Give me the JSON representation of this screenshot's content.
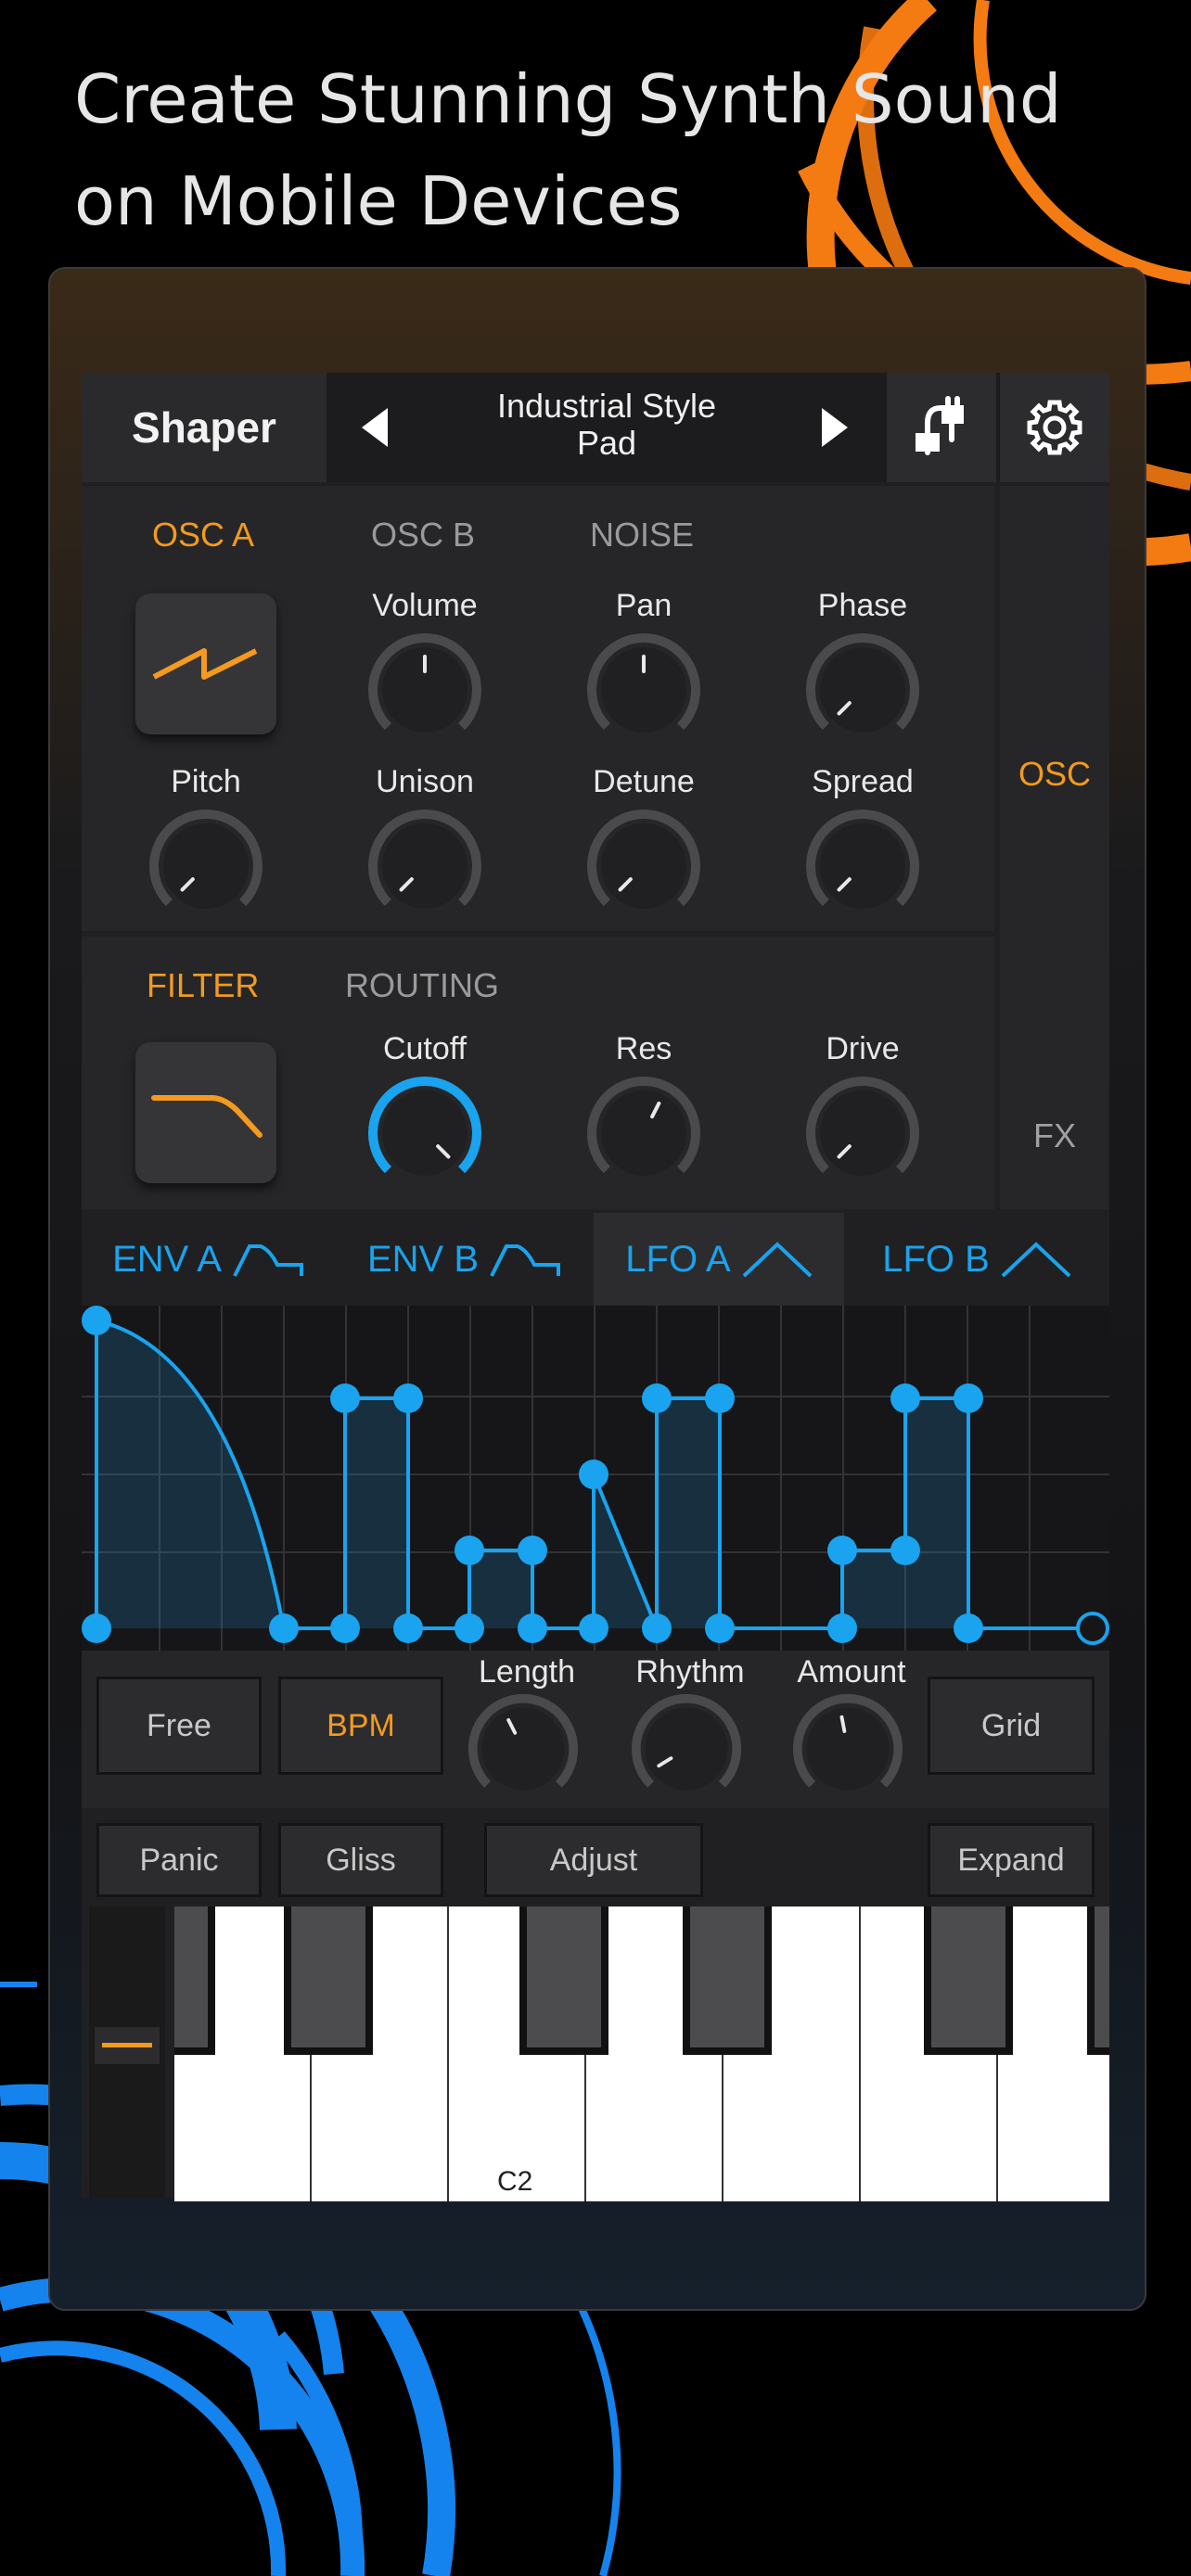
{
  "headline": {
    "line1": "Create Stunning Synth Sound",
    "line2": "on Mobile Devices"
  },
  "colors": {
    "accent_orange": "#f39a1f",
    "accent_blue": "#1aa3ee",
    "panel": "#262628",
    "background": "#000000"
  },
  "header": {
    "app_name": "Shaper",
    "preset_name_line1": "Industrial Style",
    "preset_name_line2": "Pad",
    "prev_icon": "triangle-left-icon",
    "next_icon": "triangle-right-icon",
    "routing_icon": "cable-icon",
    "settings_icon": "gear-icon"
  },
  "side_tabs": {
    "osc": "OSC",
    "fx": "FX"
  },
  "osc": {
    "tabs": [
      "OSC A",
      "OSC B",
      "NOISE"
    ],
    "active_tab": "OSC A",
    "wave_icon": "sawtooth-wave-icon",
    "knobs_row1": [
      {
        "label": "Volume",
        "value": 0.5
      },
      {
        "label": "Pan",
        "value": 0.5
      },
      {
        "label": "Phase",
        "value": 0.0
      }
    ],
    "knobs_row2": [
      {
        "label": "Pitch",
        "value": 0.0
      },
      {
        "label": "Unison",
        "value": 0.0
      },
      {
        "label": "Detune",
        "value": 0.0
      },
      {
        "label": "Spread",
        "value": 0.0
      }
    ]
  },
  "filter": {
    "tabs": [
      "FILTER",
      "ROUTING"
    ],
    "active_tab": "FILTER",
    "filter_icon": "lowpass-filter-icon",
    "knobs": [
      {
        "label": "Cutoff",
        "value": 1.0
      },
      {
        "label": "Res",
        "value": 0.6
      },
      {
        "label": "Drive",
        "value": 0.0
      }
    ]
  },
  "mod_tabs": [
    {
      "label": "ENV A",
      "icon": "envelope-icon"
    },
    {
      "label": "ENV B",
      "icon": "envelope-icon"
    },
    {
      "label": "LFO A",
      "icon": "triangle-wave-icon",
      "active": true
    },
    {
      "label": "LFO B",
      "icon": "triangle-wave-icon"
    }
  ],
  "lfo_controls": {
    "free": "Free",
    "bpm": "BPM",
    "length": {
      "label": "Length",
      "value": 0.4
    },
    "rhythm": {
      "label": "Rhythm",
      "value": 0.05
    },
    "amount": {
      "label": "Amount",
      "value": 0.46
    },
    "grid": "Grid"
  },
  "keyboard_bar": {
    "panic": "Panic",
    "gliss": "Gliss",
    "adjust": "Adjust",
    "expand": "Expand"
  },
  "keyboard": {
    "note_label": "C2"
  }
}
